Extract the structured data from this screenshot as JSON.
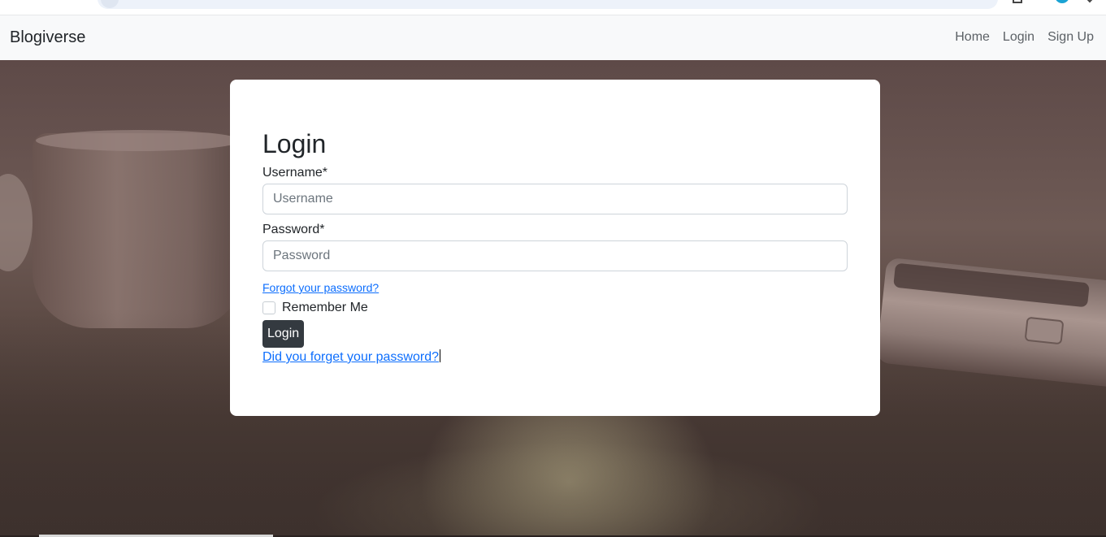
{
  "navbar": {
    "brand": "Blogiverse",
    "links": [
      "Home",
      "Login",
      "Sign Up"
    ]
  },
  "login_card": {
    "title": "Login",
    "username": {
      "label": "Username*",
      "placeholder": "Username",
      "value": ""
    },
    "password": {
      "label": "Password*",
      "placeholder": "Password",
      "value": ""
    },
    "forgot_link_small": "Forgot your password?",
    "remember_me": {
      "label": "Remember Me",
      "checked": false
    },
    "submit_label": "Login",
    "forgot_link_large": "Did you forget your password?"
  },
  "colors": {
    "navbar_bg": "#f8f9fa",
    "link": "#0d6efd",
    "button_bg": "#343a40"
  }
}
